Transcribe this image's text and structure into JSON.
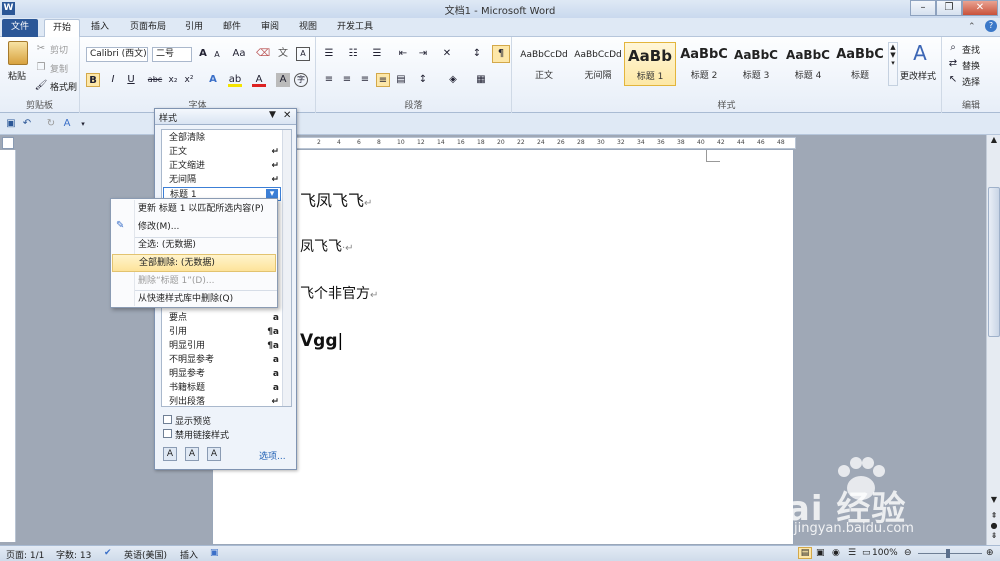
{
  "window": {
    "title": "文档1 - Microsoft Word",
    "minimize": "–",
    "restore": "❐",
    "close": "✕"
  },
  "tabs": [
    "文件",
    "开始",
    "插入",
    "页面布局",
    "引用",
    "邮件",
    "审阅",
    "视图",
    "开发工具"
  ],
  "clipboard": {
    "paste": "粘贴",
    "cut": "剪切",
    "copy": "复制",
    "format_painter": "格式刷",
    "label": "剪贴板"
  },
  "font": {
    "name": "Calibri (西文)",
    "size": "二号",
    "label": "字体",
    "bold": "B",
    "italic": "I",
    "underline": "U",
    "strike": "abc",
    "sub": "x₂",
    "sup": "x²",
    "grow": "A",
    "shrink": "A",
    "change_case": "Aa",
    "clear": "A"
  },
  "paragraph": {
    "label": "段落"
  },
  "styles": {
    "label": "样式",
    "gallery": [
      {
        "sample": "AaBbCcDd",
        "name": "正文"
      },
      {
        "sample": "AaBbCcDd",
        "name": "无间隔"
      },
      {
        "sample": "AaBb",
        "name": "标题 1"
      },
      {
        "sample": "AaBbC",
        "name": "标题 2"
      },
      {
        "sample": "AaBbC",
        "name": "标题 3"
      },
      {
        "sample": "AaBbC",
        "name": "标题 4"
      },
      {
        "sample": "AaBbC",
        "name": "标题"
      }
    ],
    "change_styles": "更改样式"
  },
  "editing": {
    "find": "查找",
    "replace": "替换",
    "select": "选择",
    "label": "编辑"
  },
  "styles_pane": {
    "title": "样式",
    "items": [
      {
        "name": "全部清除",
        "sym": ""
      },
      {
        "name": "正文",
        "sym": "↵"
      },
      {
        "name": "正文缩进",
        "sym": "↵"
      },
      {
        "name": "无间隔",
        "sym": "↵"
      },
      {
        "name": "标题 1",
        "sym": "▾"
      },
      {
        "name": "要点",
        "sym": "a"
      },
      {
        "name": "引用",
        "sym": "¶a"
      },
      {
        "name": "明显引用",
        "sym": "¶a"
      },
      {
        "name": "不明显参考",
        "sym": "a"
      },
      {
        "name": "明显参考",
        "sym": "a"
      },
      {
        "name": "书籍标题",
        "sym": "a"
      },
      {
        "name": "列出段落",
        "sym": "↵"
      }
    ],
    "show_preview": "显示预览",
    "disable_linked": "禁用链接样式",
    "options": "选项..."
  },
  "context_menu": [
    {
      "label": "更新 标题 1 以匹配所选内容(P)",
      "state": "normal"
    },
    {
      "label": "修改(M)...",
      "state": "normal"
    },
    {
      "label": "全选: (无数据)",
      "state": "normal"
    },
    {
      "label": "全部删除: (无数据)",
      "state": "highlighted"
    },
    {
      "label": "删除“标题 1”(D)...",
      "state": "disabled"
    },
    {
      "label": "从快速样式库中删除(Q)",
      "state": "normal"
    }
  ],
  "document": {
    "lines": [
      "飞凤飞飞",
      "凤飞飞",
      "飞个非官方",
      "Vgg"
    ]
  },
  "ruler_ticks": [
    "2",
    "4",
    "6",
    "8",
    "10",
    "12",
    "14",
    "16",
    "18",
    "20",
    "22",
    "24",
    "26",
    "28",
    "30",
    "32",
    "34",
    "36",
    "38",
    "40",
    "42",
    "44",
    "46",
    "48"
  ],
  "status": {
    "page": "页面: 1/1",
    "words": "字数: 13",
    "language": "英语(美国)",
    "insert": "插入",
    "zoom": "100%"
  },
  "watermark": {
    "brand": "Bai 经验",
    "url": "jingyan.baidu.com"
  }
}
